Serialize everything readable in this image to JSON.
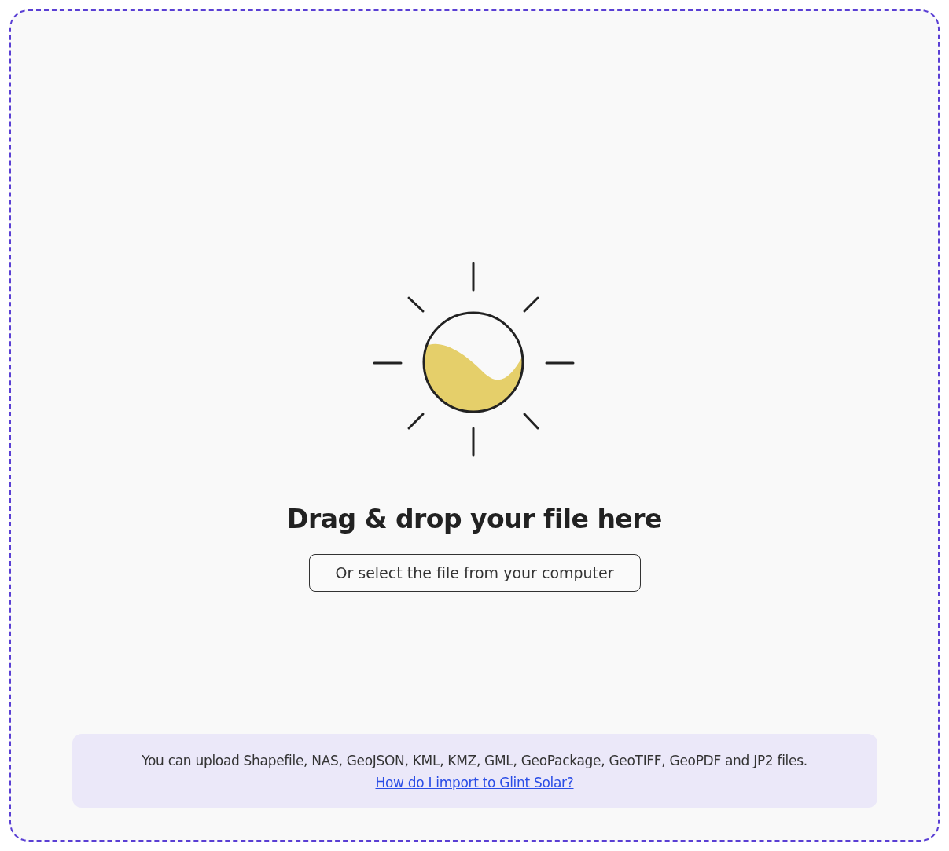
{
  "dropzone": {
    "title": "Drag & drop your file here",
    "select_button": "Or select the file from your computer"
  },
  "info": {
    "text": "You can upload Shapefile, NAS, GeoJSON, KML, KMZ, GML, GeoPackage, GeoTIFF, GeoPDF and JP2 files.",
    "link": "How do I import to Glint Solar?"
  }
}
